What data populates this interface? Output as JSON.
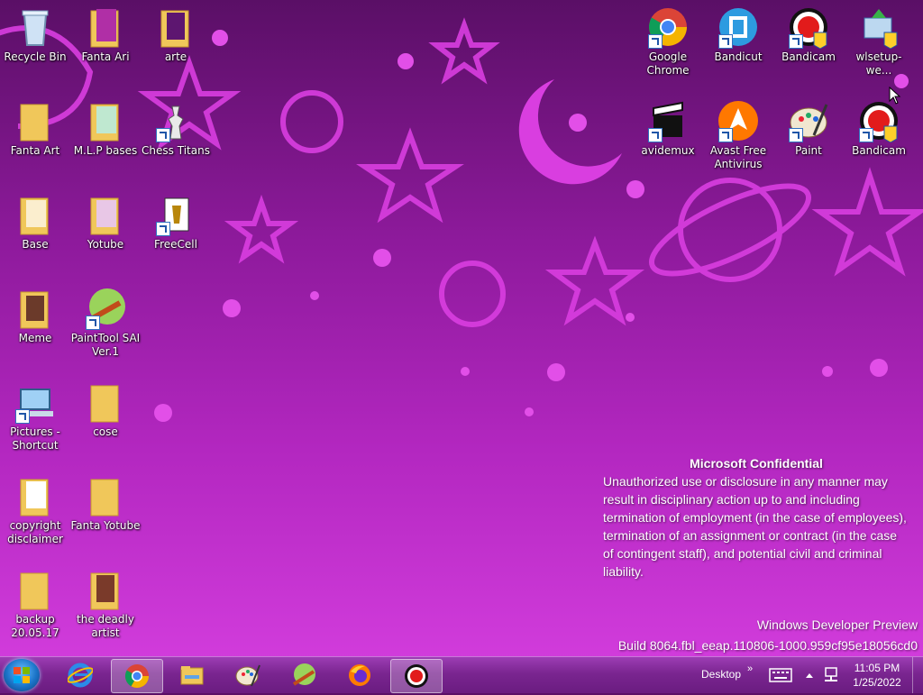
{
  "desktop": {
    "icons_left": [
      {
        "label": "Recycle Bin",
        "icon": "recycle-bin-icon"
      },
      {
        "label": "Fanta Ari",
        "icon": "folder-icon"
      },
      {
        "label": "arte",
        "icon": "folder-icon"
      },
      {
        "label": "Fanta Art",
        "icon": "folder-icon"
      },
      {
        "label": "M.L.P bases",
        "icon": "folder-icon"
      },
      {
        "label": "Chess Titans",
        "icon": "chess-icon"
      },
      {
        "label": "Base",
        "icon": "folder-icon"
      },
      {
        "label": "Yotube",
        "icon": "folder-icon"
      },
      {
        "label": "FreeCell",
        "icon": "cards-icon"
      },
      {
        "label": "Meme",
        "icon": "folder-icon"
      },
      {
        "label": "PaintTool SAI Ver.1",
        "icon": "painttool-sai-icon"
      },
      {
        "label": "Pictures - Shortcut",
        "icon": "pictures-shortcut-icon"
      },
      {
        "label": "cose",
        "icon": "folder-icon"
      },
      {
        "label": "copyright disclaimer",
        "icon": "folder-icon"
      },
      {
        "label": "Fanta Yotube",
        "icon": "folder-icon"
      },
      {
        "label": "backup 20.05.17",
        "icon": "folder-icon"
      },
      {
        "label": "the deadly artist",
        "icon": "folder-icon"
      }
    ],
    "icons_right": [
      {
        "label": "Google Chrome",
        "icon": "chrome-icon"
      },
      {
        "label": "Bandicut",
        "icon": "bandicut-icon"
      },
      {
        "label": "Bandicam",
        "icon": "bandicam-icon"
      },
      {
        "label": "wlsetup-we...",
        "icon": "installer-icon"
      },
      {
        "label": "avidemux",
        "icon": "avidemux-icon"
      },
      {
        "label": "Avast Free Antivirus",
        "icon": "avast-icon"
      },
      {
        "label": "Paint",
        "icon": "paint-icon"
      },
      {
        "label": "Bandicam",
        "icon": "bandicam-icon"
      }
    ]
  },
  "watermark": {
    "title": "Microsoft Confidential",
    "body": "Unauthorized use or disclosure in any manner may result in disciplinary action up to and including termination of employment (in the case of employees), termination of an assignment or contract (in the case of contingent staff), and potential civil and criminal liability.",
    "preview": "Windows Developer Preview",
    "build": "Build 8064.fbl_eeap.110806-1000.959cf95e18056cd0"
  },
  "taskbar": {
    "pinned": [
      {
        "icon": "internet-explorer-icon",
        "active": false
      },
      {
        "icon": "chrome-icon",
        "active": true
      },
      {
        "icon": "file-explorer-icon",
        "active": false
      },
      {
        "icon": "paint-icon",
        "active": false
      },
      {
        "icon": "painttool-sai-icon",
        "active": false
      },
      {
        "icon": "firefox-icon",
        "active": false
      },
      {
        "icon": "bandicam-icon",
        "active": true
      }
    ],
    "desktop_label": "Desktop",
    "time": "11:05 PM",
    "date": "1/25/2022"
  },
  "colors": {
    "accent": "#d63fe0",
    "taskbar": "#7a2590",
    "folder": "#f0c75a"
  }
}
